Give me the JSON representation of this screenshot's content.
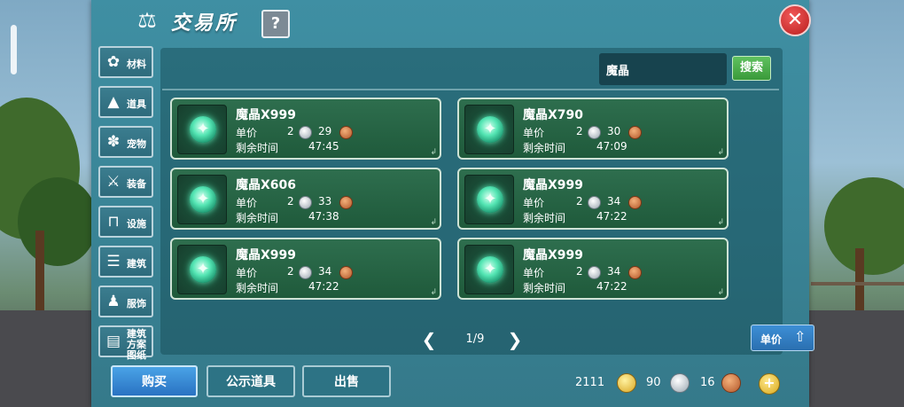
{
  "header": {
    "title": "交易所",
    "help_label": "?",
    "close_label": "✕",
    "icon": "balance-scale-icon"
  },
  "sidebar": {
    "items": [
      {
        "label": "材料",
        "icon": "material-icon"
      },
      {
        "label": "道具",
        "icon": "potion-icon"
      },
      {
        "label": "宠物",
        "icon": "paw-icon"
      },
      {
        "label": "装备",
        "icon": "equipment-icon"
      },
      {
        "label": "设施",
        "icon": "facility-icon"
      },
      {
        "label": "建筑",
        "icon": "building-icon"
      },
      {
        "label": "服饰",
        "icon": "clothing-icon"
      },
      {
        "label": "建筑方案图纸",
        "icon": "blueprint-icon"
      }
    ]
  },
  "search": {
    "value": "魔晶",
    "button_label": "搜索"
  },
  "listings": {
    "price_label": "单价",
    "time_label": "剩余时间",
    "items": [
      {
        "name": "魔晶X999",
        "silver": "2",
        "copper": "29",
        "time": "47:45"
      },
      {
        "name": "魔晶X790",
        "silver": "2",
        "copper": "30",
        "time": "47:09"
      },
      {
        "name": "魔晶X606",
        "silver": "2",
        "copper": "33",
        "time": "47:38"
      },
      {
        "name": "魔晶X999",
        "silver": "2",
        "copper": "34",
        "time": "47:22"
      },
      {
        "name": "魔晶X999",
        "silver": "2",
        "copper": "34",
        "time": "47:22"
      },
      {
        "name": "魔晶X999",
        "silver": "2",
        "copper": "34",
        "time": "47:22"
      }
    ]
  },
  "pagination": {
    "page_text": "1/9",
    "prev": "❮",
    "next": "❯"
  },
  "sort": {
    "label": "单价",
    "icon": "sort-arrow-icon"
  },
  "actions": {
    "buy": "购买",
    "show": "公示道具",
    "sell": "出售"
  },
  "currency": {
    "gold": "2111",
    "silver": "90",
    "copper": "16",
    "add_label": "+"
  },
  "colors": {
    "gold": "#d9a622",
    "silver": "#9aa6b0",
    "copper": "#b2572a",
    "accent_green": "#3a9a3a",
    "accent_blue": "#2a72c2"
  }
}
